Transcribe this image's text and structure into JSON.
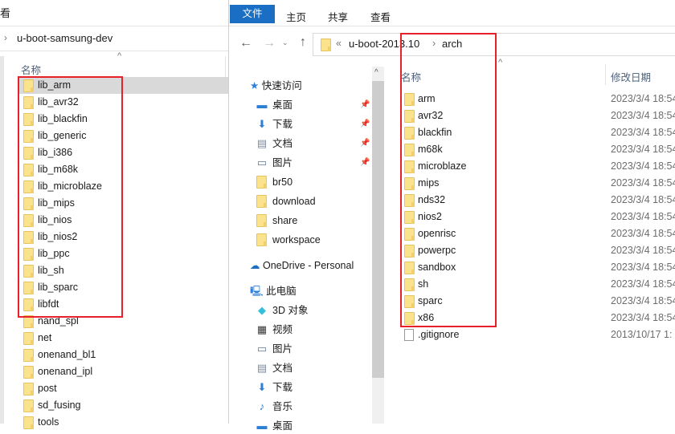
{
  "left_window": {
    "ribbon_tab_partial": "看",
    "path": "u-boot-samsung-dev",
    "column_name": "名称",
    "items": [
      "lib_arm",
      "lib_avr32",
      "lib_blackfin",
      "lib_generic",
      "lib_i386",
      "lib_m68k",
      "lib_microblaze",
      "lib_mips",
      "lib_nios",
      "lib_nios2",
      "lib_ppc",
      "lib_sh",
      "lib_sparc",
      "libfdt",
      "nand_spl",
      "net",
      "onenand_bl1",
      "onenand_ipl",
      "post",
      "sd_fusing",
      "tools"
    ],
    "selected": "lib_arm"
  },
  "right_window": {
    "ribbon_tabs": [
      "文件",
      "主页",
      "共享",
      "查看"
    ],
    "breadcrumb": {
      "overflow": "«",
      "parent": "u-boot-2013.10",
      "separator": "›",
      "current": "arch"
    },
    "nav": {
      "quick_access": "快速访问",
      "quick_items": [
        {
          "label": "桌面",
          "icon": "desktop-icon",
          "pinned": true
        },
        {
          "label": "下载",
          "icon": "download-icon",
          "pinned": true
        },
        {
          "label": "文档",
          "icon": "document-icon",
          "pinned": true
        },
        {
          "label": "图片",
          "icon": "picture-icon",
          "pinned": true
        },
        {
          "label": "br50",
          "icon": "folder-icon",
          "pinned": false
        },
        {
          "label": "download",
          "icon": "folder-icon",
          "pinned": false
        },
        {
          "label": "share",
          "icon": "folder-icon",
          "pinned": false
        },
        {
          "label": "workspace",
          "icon": "folder-icon",
          "pinned": false
        }
      ],
      "onedrive": "OneDrive - Personal",
      "this_pc": "此电脑",
      "pc_items": [
        {
          "label": "3D 对象",
          "icon": "3d-objects-icon"
        },
        {
          "label": "视频",
          "icon": "video-icon"
        },
        {
          "label": "图片",
          "icon": "picture-icon"
        },
        {
          "label": "文档",
          "icon": "document-icon"
        },
        {
          "label": "下载",
          "icon": "download-icon"
        },
        {
          "label": "音乐",
          "icon": "music-icon"
        },
        {
          "label": "桌面",
          "icon": "desktop-icon"
        }
      ]
    },
    "columns": {
      "name": "名称",
      "date": "修改日期"
    },
    "files": [
      {
        "name": "arm",
        "date": "2023/3/4 18:54",
        "type": "folder"
      },
      {
        "name": "avr32",
        "date": "2023/3/4 18:54",
        "type": "folder"
      },
      {
        "name": "blackfin",
        "date": "2023/3/4 18:54",
        "type": "folder"
      },
      {
        "name": "m68k",
        "date": "2023/3/4 18:54",
        "type": "folder"
      },
      {
        "name": "microblaze",
        "date": "2023/3/4 18:54",
        "type": "folder"
      },
      {
        "name": "mips",
        "date": "2023/3/4 18:54",
        "type": "folder"
      },
      {
        "name": "nds32",
        "date": "2023/3/4 18:54",
        "type": "folder"
      },
      {
        "name": "nios2",
        "date": "2023/3/4 18:54",
        "type": "folder"
      },
      {
        "name": "openrisc",
        "date": "2023/3/4 18:54",
        "type": "folder"
      },
      {
        "name": "powerpc",
        "date": "2023/3/4 18:54",
        "type": "folder"
      },
      {
        "name": "sandbox",
        "date": "2023/3/4 18:54",
        "type": "folder"
      },
      {
        "name": "sh",
        "date": "2023/3/4 18:54",
        "type": "folder"
      },
      {
        "name": "sparc",
        "date": "2023/3/4 18:54",
        "type": "folder"
      },
      {
        "name": "x86",
        "date": "2023/3/4 18:54",
        "type": "folder"
      },
      {
        "name": ".gitignore",
        "date": "2013/10/17 1:",
        "type": "file"
      }
    ]
  },
  "colors": {
    "accent": "#1a6fc4",
    "highlight": "#e8202a",
    "selection": "#d9d9d9"
  }
}
